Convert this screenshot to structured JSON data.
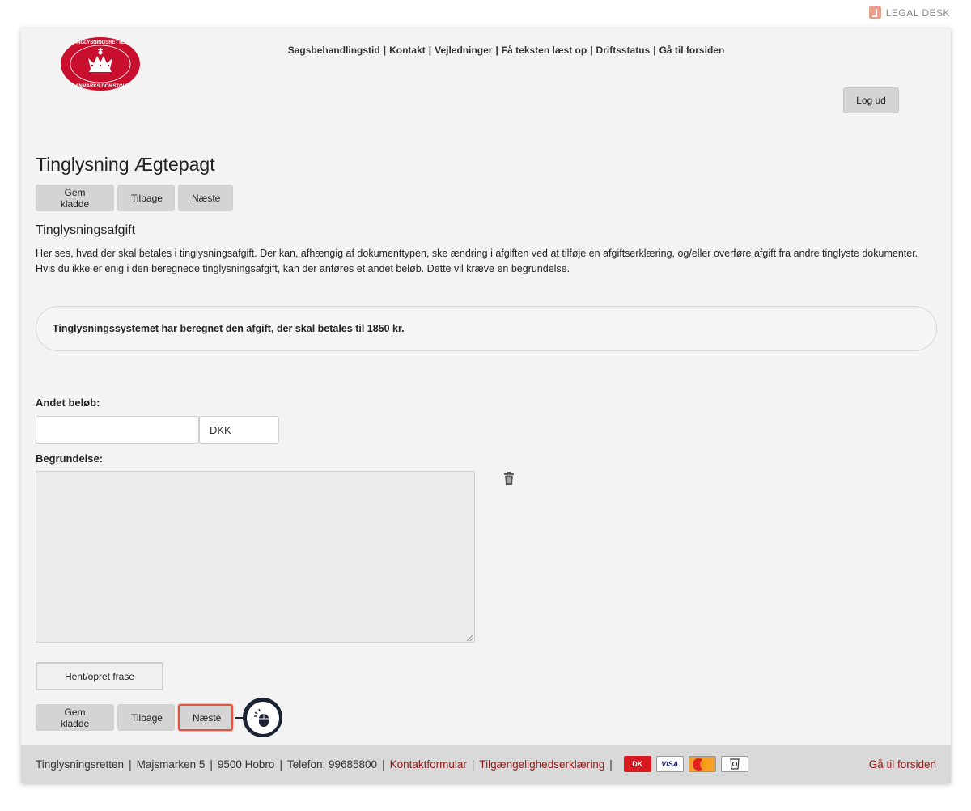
{
  "brand": {
    "label": "LEGAL DESK"
  },
  "header": {
    "nav": [
      "Sagsbehandlingstid",
      "Kontakt",
      "Vejledninger",
      "Få teksten læst op",
      "Driftsstatus",
      "Gå til forsiden"
    ],
    "logout_label": "Log ud",
    "seal_text_top": "TINGLYSNINGSRETTEN",
    "seal_text_bottom": "DANMARKS DOMSTOLE"
  },
  "main": {
    "title": "Tinglysning Ægtepagt",
    "buttons": {
      "save": "Gem kladde",
      "back": "Tilbage",
      "next": "Næste"
    },
    "section_title": "Tinglysningsafgift",
    "description": "Her ses, hvad der skal betales i tinglysningsafgift. Der kan, afhængig af dokumenttypen, ske ændring i afgiften ved at tilføje en afgiftserklæring, og/eller overføre afgift fra andre tinglyste dokumenter. Hvis du ikke er enig i den beregnede tinglysningsafgift, kan der anføres et andet beløb. Dette vil kræve en begrundelse.",
    "info": "Tinglysningssystemet har beregnet den afgift, der skal betales til 1850 kr.",
    "other_amount_label": "Andet beløb:",
    "other_amount_value": "",
    "currency": "DKK",
    "reason_label": "Begrundelse:",
    "reason_value": "",
    "phrase_button": "Hent/opret frase"
  },
  "footer": {
    "org": "Tinglysningsretten",
    "address": "Majsmarken 5",
    "city": "9500 Hobro",
    "phone": "Telefon: 99685800",
    "contact_link": "Kontaktformular",
    "accessibility_link": "Tilgængelighedserklæring",
    "home_link": "Gå til forsiden",
    "cards": [
      "DK",
      "VISA",
      "MasterCard",
      "ID"
    ]
  }
}
